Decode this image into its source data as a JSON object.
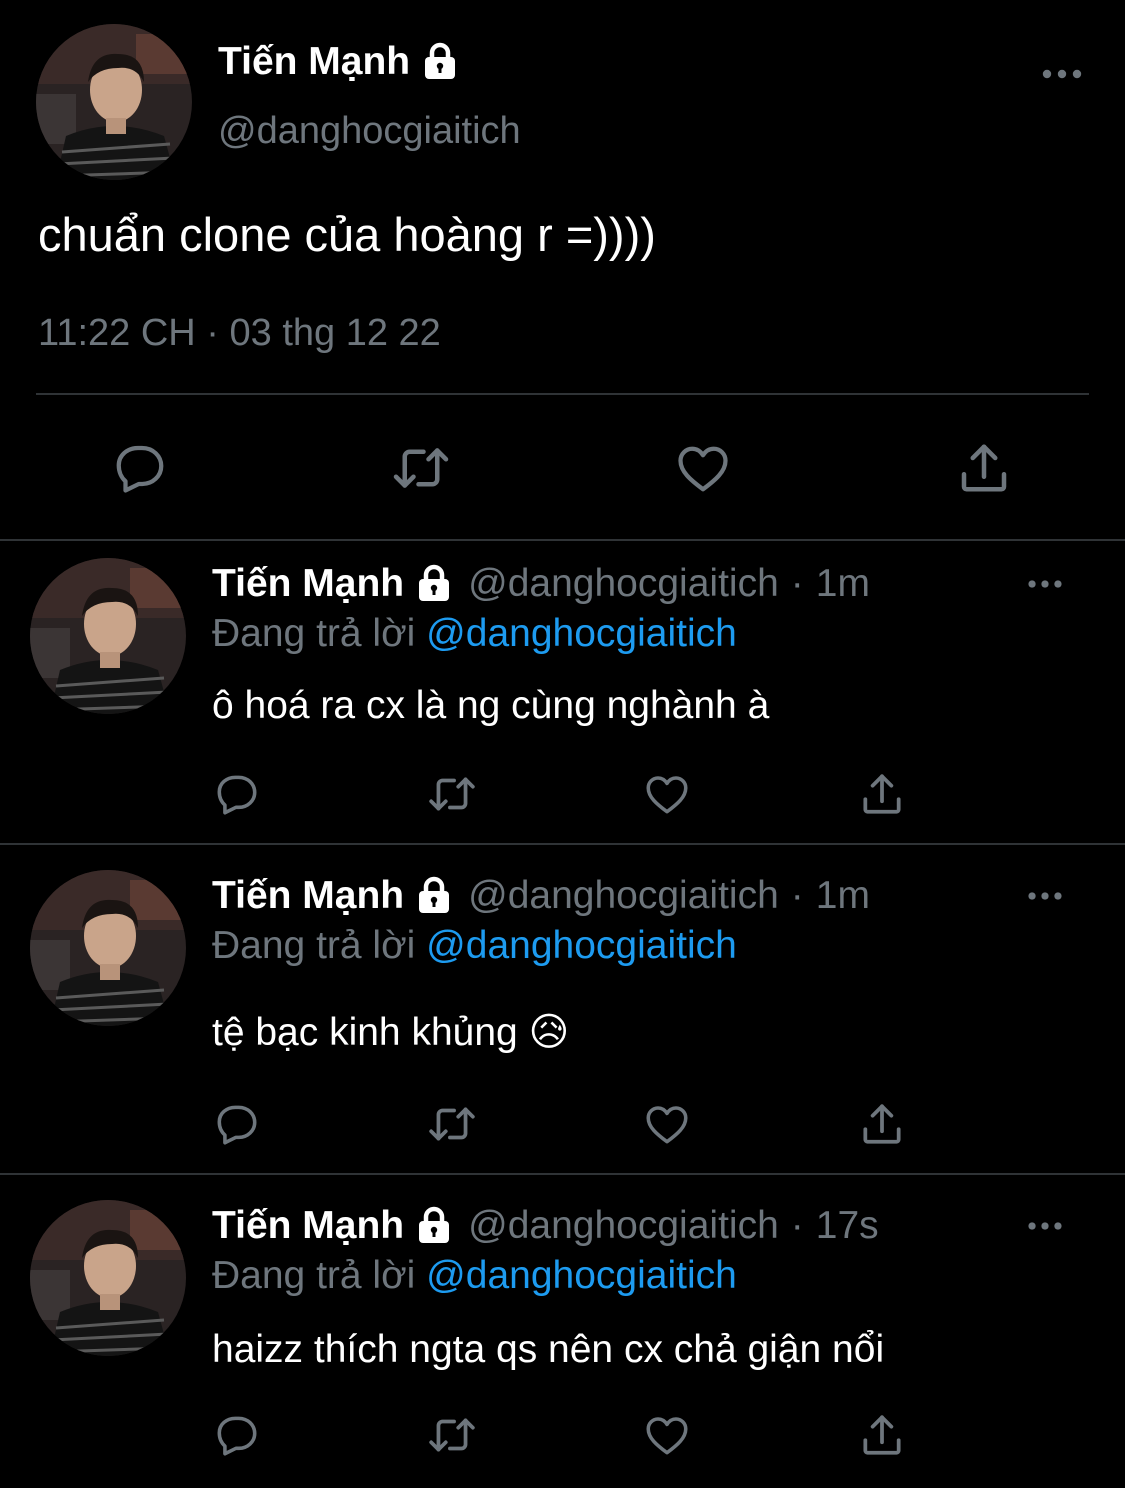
{
  "colors": {
    "background": "#000000",
    "text_primary": "#ffffff",
    "text_secondary": "#6e767d",
    "mention": "#1d9bf0",
    "divider": "#2f3336"
  },
  "main_tweet": {
    "author_name": "Tiến Mạnh",
    "handle": "@danghocgiaitich",
    "text": "chuẩn clone của hoàng r =))))",
    "time": "11:22 CH",
    "separator": "·",
    "date": "03 thg 12 22",
    "icons": [
      "lock-icon",
      "more-icon",
      "reply-icon",
      "retweet-icon",
      "like-icon",
      "share-icon"
    ]
  },
  "replies": [
    {
      "author_name": "Tiến Mạnh",
      "handle": "@danghocgiaitich",
      "separator": "·",
      "time": "1m",
      "replying_label": "Đang trả lời",
      "replying_to": "@danghocgiaitich",
      "text": "ô hoá ra cx là ng cùng nghành à"
    },
    {
      "author_name": "Tiến Mạnh",
      "handle": "@danghocgiaitich",
      "separator": "·",
      "time": "1m",
      "replying_label": "Đang trả lời",
      "replying_to": "@danghocgiaitich",
      "text": "tệ bạc kinh khủng 😥"
    },
    {
      "author_name": "Tiến Mạnh",
      "handle": "@danghocgiaitich",
      "separator": "·",
      "time": "17s",
      "replying_label": "Đang trả lời",
      "replying_to": "@danghocgiaitich",
      "text": "haizz thích ngta qs nên cx chả giận nổi"
    }
  ]
}
